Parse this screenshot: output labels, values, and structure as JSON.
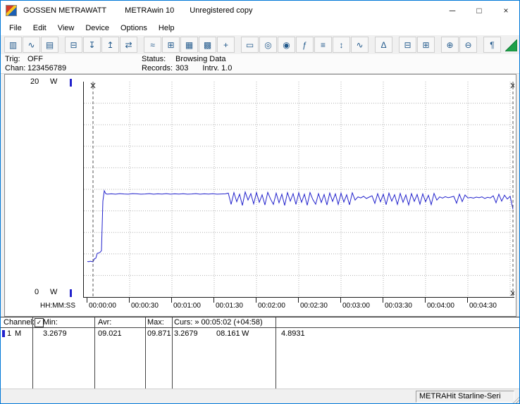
{
  "window": {
    "title": {
      "brand": "GOSSEN METRAWATT",
      "app": "METRAwin 10",
      "license": "Unregistered copy"
    },
    "controls": {
      "minimize": "─",
      "maximize": "□",
      "close": "×"
    }
  },
  "menu": {
    "items": [
      "File",
      "Edit",
      "View",
      "Device",
      "Options",
      "Help"
    ]
  },
  "toolbar": {
    "groups": [
      [
        {
          "name": "save",
          "glyph": "▥"
        },
        {
          "name": "curve-file",
          "glyph": "∿"
        },
        {
          "name": "open",
          "glyph": "▤"
        }
      ],
      [
        {
          "name": "print-form",
          "glyph": "⊟"
        },
        {
          "name": "export",
          "glyph": "↧"
        },
        {
          "name": "import",
          "glyph": "↥"
        },
        {
          "name": "transfer",
          "glyph": "⇄"
        }
      ],
      [
        {
          "name": "multi-curve",
          "glyph": "≈"
        },
        {
          "name": "zoom-window",
          "glyph": "⊞"
        },
        {
          "name": "table-view",
          "glyph": "▦"
        },
        {
          "name": "matrix-view",
          "glyph": "▩"
        },
        {
          "name": "cursor",
          "glyph": "+"
        }
      ],
      [
        {
          "name": "digital-display",
          "glyph": "▭"
        },
        {
          "name": "analog-display",
          "glyph": "◎"
        },
        {
          "name": "meter",
          "glyph": "◉"
        },
        {
          "name": "fx",
          "glyph": "ƒ"
        },
        {
          "name": "memory",
          "glyph": "≡"
        },
        {
          "name": "minmax",
          "glyph": "↕"
        },
        {
          "name": "envelope",
          "glyph": "∿"
        }
      ],
      [
        {
          "name": "trigger-bell",
          "glyph": "Δ"
        }
      ],
      [
        {
          "name": "print-graph",
          "glyph": "⊟"
        },
        {
          "name": "print-list",
          "glyph": "⊞"
        }
      ],
      [
        {
          "name": "zoom-in-time",
          "glyph": "⊕"
        },
        {
          "name": "zoom-out-time",
          "glyph": "⊖"
        }
      ],
      [
        {
          "name": "comment",
          "glyph": "¶"
        }
      ]
    ]
  },
  "status_panel": {
    "trig_label": "Trig:",
    "trig_value": "OFF",
    "chan_label": "Chan:",
    "chan_value": "123456789",
    "status_label": "Status:",
    "status_value": "Browsing Data",
    "records_label": "Records:",
    "records_value": "303",
    "interval_label": "Intrv.",
    "interval_value": "1.0"
  },
  "chart_data": {
    "type": "line",
    "title": "",
    "xlabel": "HH:MM:SS",
    "ylabel": "W",
    "ylim": [
      0,
      20
    ],
    "xlim_seconds": [
      0,
      302
    ],
    "grid": true,
    "y_gridline_step": 2,
    "x_tick_step_seconds": 30,
    "x_tick_labels": [
      "00:00:00",
      "00:00:30",
      "00:01:00",
      "00:01:30",
      "00:02:00",
      "00:02:30",
      "00:03:00",
      "00:03:30",
      "00:04:00",
      "00:04:30"
    ],
    "y_axis_labels": {
      "top": "20",
      "bottom": "0",
      "unit": "W"
    },
    "cursors": {
      "left_seconds": 4,
      "right_seconds": 302,
      "left_value": 3.2679,
      "right_value": 8.161,
      "label": "Curs: » 00:05:02 (+04:58)"
    },
    "series": [
      {
        "name": "channel-1-power-W",
        "color": "#2222cc",
        "points": [
          [
            0,
            3.3
          ],
          [
            1,
            3.28
          ],
          [
            2,
            3.33
          ],
          [
            3,
            3.3
          ],
          [
            4,
            3.27
          ],
          [
            5,
            3.55
          ],
          [
            6,
            3.6
          ],
          [
            7,
            4.05
          ],
          [
            8,
            4.1
          ],
          [
            9,
            4.15
          ],
          [
            10,
            4.3
          ],
          [
            11,
            8.9
          ],
          [
            12,
            9.87
          ],
          [
            13,
            9.6
          ],
          [
            14,
            9.55
          ],
          [
            17,
            9.58
          ],
          [
            20,
            9.55
          ],
          [
            23,
            9.6
          ],
          [
            26,
            9.57
          ],
          [
            29,
            9.55
          ],
          [
            32,
            9.6
          ],
          [
            35,
            9.58
          ],
          [
            38,
            9.55
          ],
          [
            41,
            9.57
          ],
          [
            44,
            9.6
          ],
          [
            47,
            9.55
          ],
          [
            50,
            9.58
          ],
          [
            53,
            9.56
          ],
          [
            56,
            9.6
          ],
          [
            59,
            9.55
          ],
          [
            62,
            9.58
          ],
          [
            65,
            9.56
          ],
          [
            68,
            9.59
          ],
          [
            71,
            9.55
          ],
          [
            74,
            9.57
          ],
          [
            77,
            9.6
          ],
          [
            80,
            9.55
          ],
          [
            83,
            9.58
          ],
          [
            86,
            9.56
          ],
          [
            89,
            9.59
          ],
          [
            92,
            9.55
          ],
          [
            95,
            9.57
          ],
          [
            98,
            9.58
          ],
          [
            100,
            9.65
          ],
          [
            102,
            8.6
          ],
          [
            104,
            9.7
          ],
          [
            106,
            8.85
          ],
          [
            108,
            9.55
          ],
          [
            110,
            8.5
          ],
          [
            112,
            9.75
          ],
          [
            114,
            9.0
          ],
          [
            116,
            9.6
          ],
          [
            118,
            8.65
          ],
          [
            120,
            9.7
          ],
          [
            122,
            8.8
          ],
          [
            124,
            9.5
          ],
          [
            126,
            8.55
          ],
          [
            128,
            9.72
          ],
          [
            130,
            9.1
          ],
          [
            132,
            8.6
          ],
          [
            134,
            9.65
          ],
          [
            136,
            8.75
          ],
          [
            138,
            9.55
          ],
          [
            140,
            8.5
          ],
          [
            142,
            9.7
          ],
          [
            144,
            8.9
          ],
          [
            146,
            9.6
          ],
          [
            148,
            8.6
          ],
          [
            150,
            9.68
          ],
          [
            152,
            8.8
          ],
          [
            154,
            9.55
          ],
          [
            156,
            8.52
          ],
          [
            158,
            9.7
          ],
          [
            160,
            9.05
          ],
          [
            162,
            8.62
          ],
          [
            164,
            9.6
          ],
          [
            166,
            8.78
          ],
          [
            168,
            9.52
          ],
          [
            170,
            8.55
          ],
          [
            172,
            9.66
          ],
          [
            174,
            8.88
          ],
          [
            176,
            9.58
          ],
          [
            178,
            8.6
          ],
          [
            180,
            9.64
          ],
          [
            182,
            8.82
          ],
          [
            184,
            9.5
          ],
          [
            186,
            8.56
          ],
          [
            188,
            9.68
          ],
          [
            190,
            9.0
          ],
          [
            192,
            9.3
          ],
          [
            194,
            9.2
          ],
          [
            196,
            9.35
          ],
          [
            198,
            9.15
          ],
          [
            200,
            9.28
          ],
          [
            202,
            9.4
          ],
          [
            204,
            8.7
          ],
          [
            206,
            9.6
          ],
          [
            208,
            8.85
          ],
          [
            210,
            9.55
          ],
          [
            212,
            8.58
          ],
          [
            214,
            9.65
          ],
          [
            216,
            8.9
          ],
          [
            218,
            9.5
          ],
          [
            220,
            8.6
          ],
          [
            222,
            9.62
          ],
          [
            224,
            8.8
          ],
          [
            226,
            9.48
          ],
          [
            228,
            8.55
          ],
          [
            230,
            9.6
          ],
          [
            232,
            8.88
          ],
          [
            234,
            9.52
          ],
          [
            236,
            8.62
          ],
          [
            238,
            9.58
          ],
          [
            240,
            8.85
          ],
          [
            242,
            9.45
          ],
          [
            244,
            8.58
          ],
          [
            246,
            9.62
          ],
          [
            248,
            9.0
          ],
          [
            250,
            9.3
          ],
          [
            252,
            9.18
          ],
          [
            254,
            9.32
          ],
          [
            256,
            9.22
          ],
          [
            258,
            9.28
          ],
          [
            260,
            9.35
          ],
          [
            262,
            8.72
          ],
          [
            264,
            9.55
          ],
          [
            266,
            8.86
          ],
          [
            268,
            9.48
          ],
          [
            270,
            9.2
          ],
          [
            272,
            9.25
          ],
          [
            274,
            9.18
          ],
          [
            276,
            9.28
          ],
          [
            278,
            9.22
          ],
          [
            280,
            9.3
          ],
          [
            282,
            9.15
          ],
          [
            284,
            9.26
          ],
          [
            286,
            9.2
          ],
          [
            288,
            9.4
          ],
          [
            290,
            8.75
          ],
          [
            292,
            9.55
          ],
          [
            294,
            8.9
          ],
          [
            296,
            9.45
          ],
          [
            298,
            9.1
          ],
          [
            300,
            9.35
          ],
          [
            302,
            8.16
          ]
        ]
      }
    ]
  },
  "table": {
    "header": {
      "channel": "Channel:",
      "check": "✓",
      "min": "Min:",
      "avr": "Avr:",
      "max": "Max:",
      "curs": "Curs: » 00:05:02 (+04:58)"
    },
    "row": {
      "num": "1",
      "mode": "M",
      "min": "3.2679",
      "avr": "09.021",
      "max": "09.871",
      "curs_a": "3.2679",
      "curs_b": "08.161",
      "unit": "W",
      "delta": "4.8931"
    }
  },
  "status_bar": {
    "device": "METRAHit Starline-Seri"
  },
  "colors": {
    "accent_blue": "#0078d7",
    "trace_blue": "#2222cc",
    "grid_gray": "#b0b0b0",
    "triangle_green": "#1fa04a"
  }
}
